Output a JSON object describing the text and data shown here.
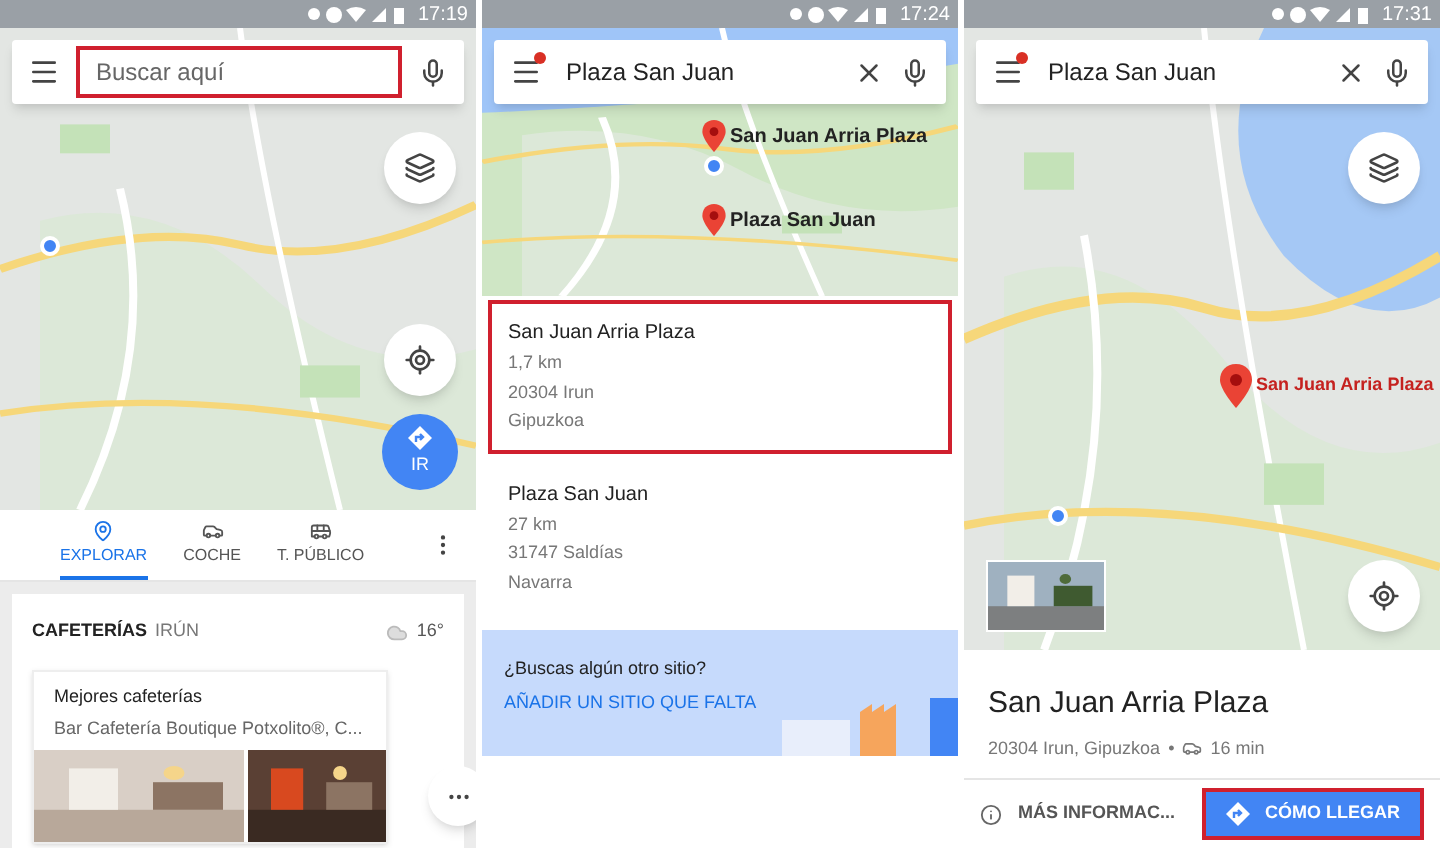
{
  "panels": [
    {
      "kind": "home",
      "status_bar": {
        "time": "17:19"
      },
      "search": {
        "placeholder": "Buscar aquí",
        "highlighted": true
      },
      "go_button": {
        "label": "IR"
      },
      "tabs": [
        {
          "label": "EXPLORAR",
          "selected": true
        },
        {
          "label": "COCHE",
          "selected": false
        },
        {
          "label": "T. PÚBLICO",
          "selected": false
        }
      ],
      "explore_card": {
        "category": "CAFETERÍAS",
        "place": "IRÚN",
        "temperature": "16°",
        "list": {
          "title": "Mejores cafeterías",
          "subtitle": "Bar Cafetería Boutique Potxolito®, C..."
        }
      }
    },
    {
      "kind": "results",
      "status_bar": {
        "time": "17:24"
      },
      "search": {
        "value": "Plaza San Juan"
      },
      "map_pins": [
        {
          "label": "San Juan Arria Plaza"
        },
        {
          "label": "Plaza San Juan"
        }
      ],
      "results": [
        {
          "name": "San Juan Arria Plaza",
          "distance": "1,7 km",
          "postcode_city": "20304 Irun",
          "region": "Gipuzkoa",
          "highlighted": true
        },
        {
          "name": "Plaza San Juan",
          "distance": "27 km",
          "postcode_city": "31747 Saldías",
          "region": "Navarra",
          "highlighted": false
        }
      ],
      "banner": {
        "question": "¿Buscas algún otro sitio?",
        "link": "AÑADIR UN SITIO QUE FALTA"
      }
    },
    {
      "kind": "place",
      "status_bar": {
        "time": "17:31"
      },
      "search": {
        "value": "Plaza San Juan"
      },
      "map_pins": [
        {
          "label": "San Juan Arria Plaza"
        }
      ],
      "place": {
        "name": "San Juan Arria Plaza",
        "address": "20304 Irun, Gipuzkoa",
        "separator": "•",
        "drive_time": "16 min"
      },
      "actions": [
        {
          "kind": "text",
          "label": "MÁS INFORMAC...",
          "highlighted": false
        },
        {
          "kind": "primary",
          "label": "CÓMO LLEGAR",
          "highlighted": true
        }
      ]
    }
  ]
}
